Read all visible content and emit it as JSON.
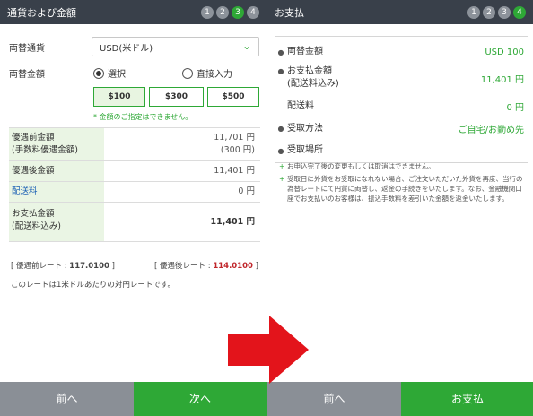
{
  "left": {
    "title": "通貨および金額",
    "steps": [
      "1",
      "2",
      "3",
      "4"
    ],
    "currency_label": "両替通貨",
    "currency_value": "USD(米ドル)",
    "amount_label": "両替金額",
    "radio_select": "選択",
    "radio_direct": "直接入力",
    "amount_buttons": [
      "$100",
      "$300",
      "$500"
    ],
    "amount_note": "* 金額のご指定はできません。",
    "calc": {
      "pre_label_1": "優遇前金額",
      "pre_label_2": "(手数料優遇金額)",
      "pre_value_1": "11,701 円",
      "pre_value_2": "(300 円)",
      "post_label": "優遇後金額",
      "post_value": "11,401 円",
      "shipping_label": "配送料",
      "shipping_value": "0 円",
      "pay_label_1": "お支払金額",
      "pay_label_2": "(配送料込み)",
      "pay_value": "11,401 円"
    },
    "rate_before_prefix": "[ 優遇前レート : ",
    "rate_before_value": "117.0100",
    "rate_after_prefix": "[ 優遇後レート : ",
    "rate_after_value": "114.0100",
    "rate_suffix": " ]",
    "rate_note": "このレートは1米ドルあたりの対円レートです。",
    "btn_back": "前へ",
    "btn_next": "次へ"
  },
  "right": {
    "title": "お支払",
    "steps": [
      "1",
      "2",
      "3",
      "4"
    ],
    "rows": {
      "exchange_label": "両替金額",
      "exchange_value": "USD 100",
      "pay_label_1": "お支払金額",
      "pay_label_2": "(配送料込み)",
      "pay_value": "11,401 円",
      "shipping_label": "配送料",
      "shipping_value": "0 円",
      "receive_method_label": "受取方法",
      "receive_method_value": "ご自宅/お勤め先",
      "receive_place_label": "受取場所"
    },
    "notes": [
      "お申込完了後の変更もしくは取消はできません。",
      "受取日に外貨をお受取になれない場合、ご注文いただいた外貨を再度、当行の為替レートにて円貨に両替し、返金の手続きをいたします。なお、金融機関口座でお支払いのお客様は、振込手数料を差引いた金額を返金いたします。"
    ],
    "btn_back": "前へ",
    "btn_pay": "お支払"
  },
  "colors": {
    "accent_green": "#2ea836",
    "header_dark": "#39404a",
    "arrow_red": "#e3141b",
    "button_gray": "#8a8f96"
  }
}
